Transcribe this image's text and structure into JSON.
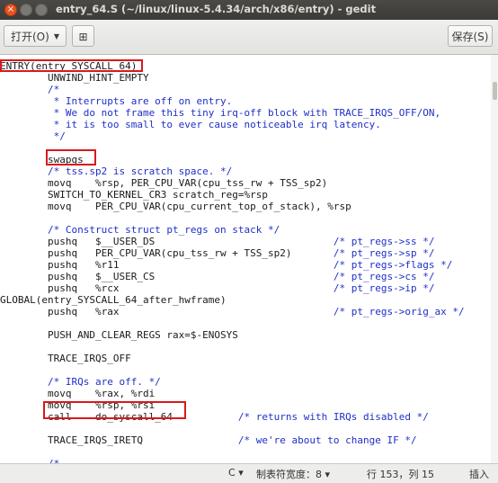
{
  "window": {
    "title": "entry_64.S (~/linux/linux-5.4.34/arch/x86/entry) - gedit",
    "close_glyph": "×"
  },
  "toolbar": {
    "open_label": "打开(O)",
    "open_arrow": "▼",
    "new_tab_icon": "⊞",
    "save_label": "保存(S)"
  },
  "editor": {
    "lines": [
      {
        "segments": [
          {
            "text": "ENTRY(entry_SYSCALL_64)",
            "class": "c-pre"
          }
        ]
      },
      {
        "segments": [
          {
            "text": "        UNWIND_HINT_EMPTY",
            "class": "c-pre"
          }
        ]
      },
      {
        "segments": [
          {
            "text": "        /*",
            "class": "c-comment"
          }
        ]
      },
      {
        "segments": [
          {
            "text": "         * Interrupts are off on entry.",
            "class": "c-comment"
          }
        ]
      },
      {
        "segments": [
          {
            "text": "         * We do not frame this tiny irq-off block with TRACE_IRQS_OFF/ON,",
            "class": "c-comment"
          }
        ]
      },
      {
        "segments": [
          {
            "text": "         * it is too small to ever cause noticeable irq latency.",
            "class": "c-comment"
          }
        ]
      },
      {
        "segments": [
          {
            "text": "         */",
            "class": "c-comment"
          }
        ]
      },
      {
        "segments": []
      },
      {
        "segments": [
          {
            "text": "        swapgs",
            "class": "c-pre"
          }
        ]
      },
      {
        "segments": [
          {
            "text": "        /* tss.sp2 is scratch space. */",
            "class": "c-comment"
          }
        ]
      },
      {
        "segments": [
          {
            "text": "        movq    %rsp, PER_CPU_VAR(cpu_tss_rw + TSS_sp2)",
            "class": "c-pre"
          }
        ]
      },
      {
        "segments": [
          {
            "text": "        SWITCH_TO_KERNEL_CR3 scratch_reg=%rsp",
            "class": "c-pre"
          }
        ]
      },
      {
        "segments": [
          {
            "text": "        movq    PER_CPU_VAR(cpu_current_top_of_stack), %rsp",
            "class": "c-pre"
          }
        ]
      },
      {
        "segments": []
      },
      {
        "segments": [
          {
            "text": "        /* Construct struct pt_regs on stack */",
            "class": "c-comment"
          }
        ]
      },
      {
        "segments": [
          {
            "text": "        pushq   $__USER_DS                              ",
            "class": "c-pre"
          },
          {
            "text": "/* pt_regs->ss */",
            "class": "c-comment"
          }
        ]
      },
      {
        "segments": [
          {
            "text": "        pushq   PER_CPU_VAR(cpu_tss_rw + TSS_sp2)       ",
            "class": "c-pre"
          },
          {
            "text": "/* pt_regs->sp */",
            "class": "c-comment"
          }
        ]
      },
      {
        "segments": [
          {
            "text": "        pushq   %r11                                    ",
            "class": "c-pre"
          },
          {
            "text": "/* pt_regs->flags */",
            "class": "c-comment"
          }
        ]
      },
      {
        "segments": [
          {
            "text": "        pushq   $__USER_CS                              ",
            "class": "c-pre"
          },
          {
            "text": "/* pt_regs->cs */",
            "class": "c-comment"
          }
        ]
      },
      {
        "segments": [
          {
            "text": "        pushq   %rcx                                    ",
            "class": "c-pre"
          },
          {
            "text": "/* pt_regs->ip */",
            "class": "c-comment"
          }
        ]
      },
      {
        "segments": [
          {
            "text": "GLOBAL(entry_SYSCALL_64_after_hwframe)",
            "class": "c-pre"
          }
        ]
      },
      {
        "segments": [
          {
            "text": "        pushq   %rax                                    ",
            "class": "c-pre"
          },
          {
            "text": "/* pt_regs->orig_ax */",
            "class": "c-comment"
          }
        ]
      },
      {
        "segments": []
      },
      {
        "segments": [
          {
            "text": "        PUSH_AND_CLEAR_REGS rax=$-ENOSYS",
            "class": "c-pre"
          }
        ]
      },
      {
        "segments": []
      },
      {
        "segments": [
          {
            "text": "        TRACE_IRQS_OFF",
            "class": "c-pre"
          }
        ]
      },
      {
        "segments": []
      },
      {
        "segments": [
          {
            "text": "        /* IRQs are off. */",
            "class": "c-comment"
          }
        ]
      },
      {
        "segments": [
          {
            "text": "        movq    %rax, %rdi",
            "class": "c-pre"
          }
        ]
      },
      {
        "segments": [
          {
            "text": "        movq    %rsp, %rsi",
            "class": "c-pre"
          }
        ]
      },
      {
        "segments": [
          {
            "text": "        call    do_syscall_64           ",
            "class": "c-pre"
          },
          {
            "text": "/* returns with IRQs disabled */",
            "class": "c-comment"
          }
        ]
      },
      {
        "segments": []
      },
      {
        "segments": [
          {
            "text": "        TRACE_IRQS_IRETQ                ",
            "class": "c-pre"
          },
          {
            "text": "/* we're about to change IF */",
            "class": "c-comment"
          }
        ]
      },
      {
        "segments": []
      },
      {
        "segments": [
          {
            "text": "        /*",
            "class": "c-comment"
          }
        ]
      }
    ]
  },
  "status": {
    "language": "C",
    "language_arrow": "▾",
    "tab_width": "制表符宽度：8",
    "tab_arrow": "▾",
    "position": "行 153，列 15",
    "mode": "插入"
  },
  "colors": {
    "highlight": "#d8191c",
    "comment": "#1f2fc8",
    "titlebar": "#3c3b37",
    "close": "#e95420"
  }
}
